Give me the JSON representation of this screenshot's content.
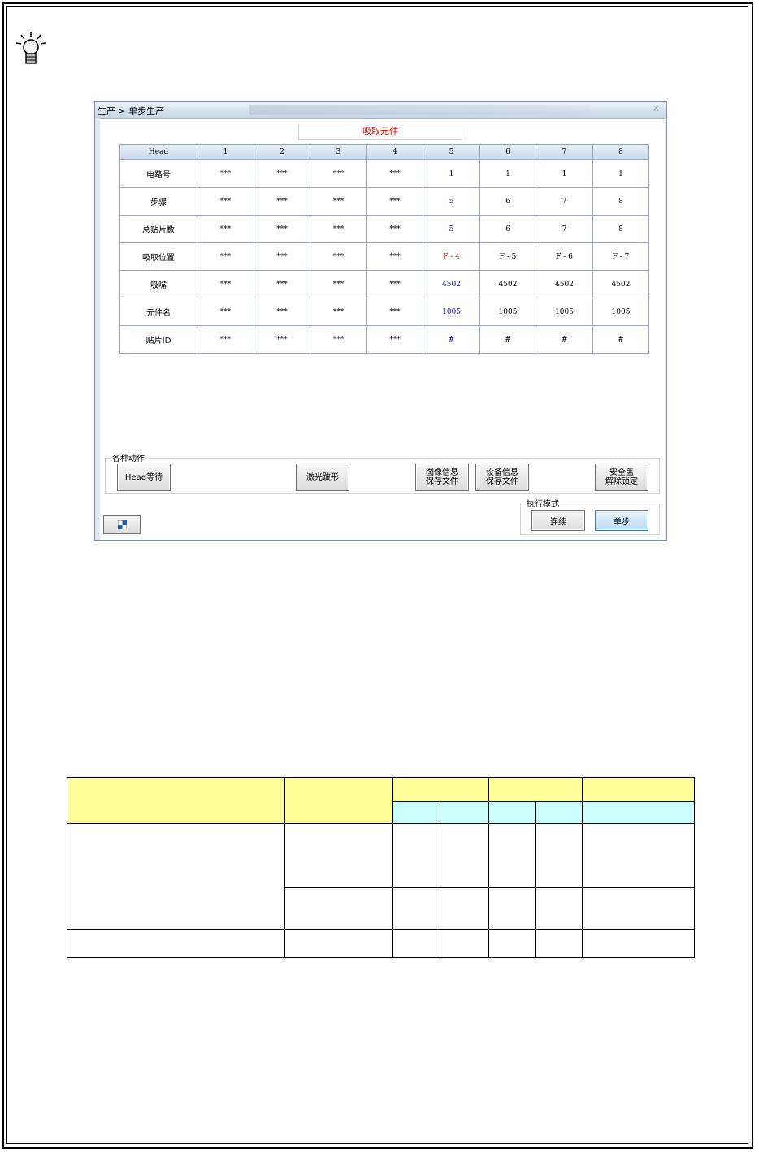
{
  "window": {
    "breadcrumb": "生产 > 单步生产",
    "pick_label": "吸取元件"
  },
  "grid": {
    "columns": [
      "Head",
      "1",
      "2",
      "3",
      "4",
      "5",
      "6",
      "7",
      "8"
    ],
    "rows": [
      {
        "label": "电路号",
        "cells": [
          "***",
          "***",
          "***",
          "***",
          "1",
          "1",
          "1",
          "1"
        ]
      },
      {
        "label": "步骤",
        "cells": [
          "***",
          "***",
          "***",
          "***",
          "5",
          "6",
          "7",
          "8"
        ]
      },
      {
        "label": "总贴片数",
        "cells": [
          "***",
          "***",
          "***",
          "***",
          "5",
          "6",
          "7",
          "8"
        ]
      },
      {
        "label": "吸取位置",
        "cells": [
          "***",
          "***",
          "***",
          "***",
          "F - 4",
          "F - 5",
          "F - 6",
          "F - 7"
        ]
      },
      {
        "label": "吸嘴",
        "cells": [
          "***",
          "***",
          "***",
          "***",
          "4502",
          "4502",
          "4502",
          "4502"
        ]
      },
      {
        "label": "元件名",
        "cells": [
          "***",
          "***",
          "***",
          "***",
          "1005",
          "1005",
          "1005",
          "1005"
        ]
      },
      {
        "label": "贴片ID",
        "cells": [
          "***",
          "***",
          "***",
          "***",
          "#",
          "#",
          "#",
          "#"
        ]
      }
    ]
  },
  "actions": {
    "group_title": "各种动作",
    "head_wait": "Head等待",
    "laser": "激光跛形",
    "image_save": "图像信息\n保存文件",
    "device_save": "设备信息\n保存文件",
    "safety_unlock": "安全盖\n解除锁定"
  },
  "mode": {
    "group_title": "执行模式",
    "continuous": "连续",
    "single": "单步"
  },
  "colors": {
    "highlight_blue": "#0000c8",
    "highlight_red": "#e00000",
    "table_yellow": "#ffff99",
    "table_cyan": "#ccffff"
  }
}
